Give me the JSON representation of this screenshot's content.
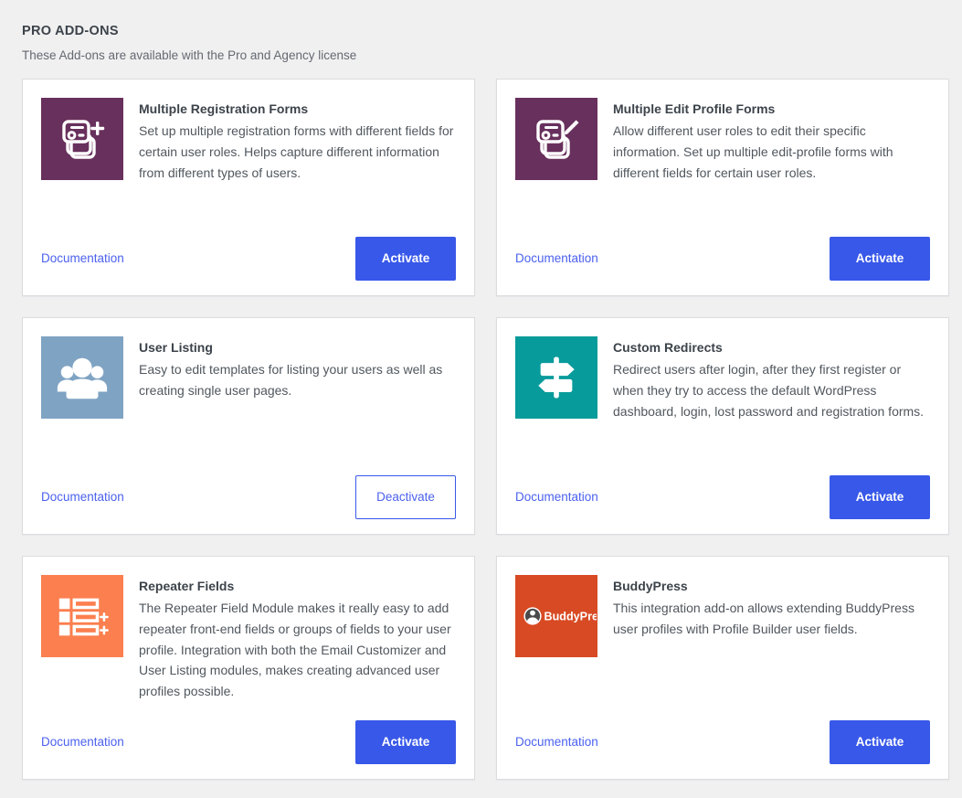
{
  "section": {
    "title": "PRO ADD-ONS",
    "subtitle": "These Add-ons are available with the Pro and Agency license"
  },
  "colors": {
    "page_background": "#f0f0f1",
    "card_background": "#ffffff",
    "card_border": "#dcdcde",
    "accent_blue": "#3858e9",
    "link_blue": "#4b61ee",
    "title_text": "#3c434a",
    "body_text": "#50575e",
    "subtitle_text": "#646970"
  },
  "addons": [
    {
      "title": "Multiple Registration Forms",
      "description": "Set up multiple registration forms with different fields for certain user roles. Helps capture different information from different types of users.",
      "icon_name": "multiple-registration-forms-icon",
      "icon_background": "#68305c",
      "doc_label": "Documentation",
      "button_label": "Activate",
      "button_style": "primary"
    },
    {
      "title": "Multiple Edit Profile Forms",
      "description": "Allow different user roles to edit their specific information. Set up multiple edit-profile forms with different fields for certain user roles.",
      "icon_name": "multiple-edit-profile-forms-icon",
      "icon_background": "#68305c",
      "doc_label": "Documentation",
      "button_label": "Activate",
      "button_style": "primary"
    },
    {
      "title": "User Listing",
      "description": "Easy to edit templates for listing your users as well as creating single user pages.",
      "icon_name": "user-listing-icon",
      "icon_background": "#7fa3c3",
      "doc_label": "Documentation",
      "button_label": "Deactivate",
      "button_style": "secondary"
    },
    {
      "title": "Custom Redirects",
      "description": "Redirect users after login, after they first register or when they try to access the default WordPress dashboard, login, lost password and registration forms.",
      "icon_name": "custom-redirects-icon",
      "icon_background": "#089b9b",
      "doc_label": "Documentation",
      "button_label": "Activate",
      "button_style": "primary"
    },
    {
      "title": "Repeater Fields",
      "description": "The Repeater Field Module makes it really easy to add repeater front-end fields or groups of fields to your user profile. Integration with both the Email Customizer and User Listing modules, makes creating advanced user profiles possible.",
      "icon_name": "repeater-fields-icon",
      "icon_background": "#fc7f4f",
      "doc_label": "Documentation",
      "button_label": "Activate",
      "button_style": "primary"
    },
    {
      "title": "BuddyPress",
      "description": "This integration add-on allows extending BuddyPress user profiles with Profile Builder user fields.",
      "icon_name": "buddypress-icon",
      "icon_background": "#d84a23",
      "icon_text": "BuddyPress",
      "doc_label": "Documentation",
      "button_label": "Activate",
      "button_style": "primary"
    }
  ]
}
